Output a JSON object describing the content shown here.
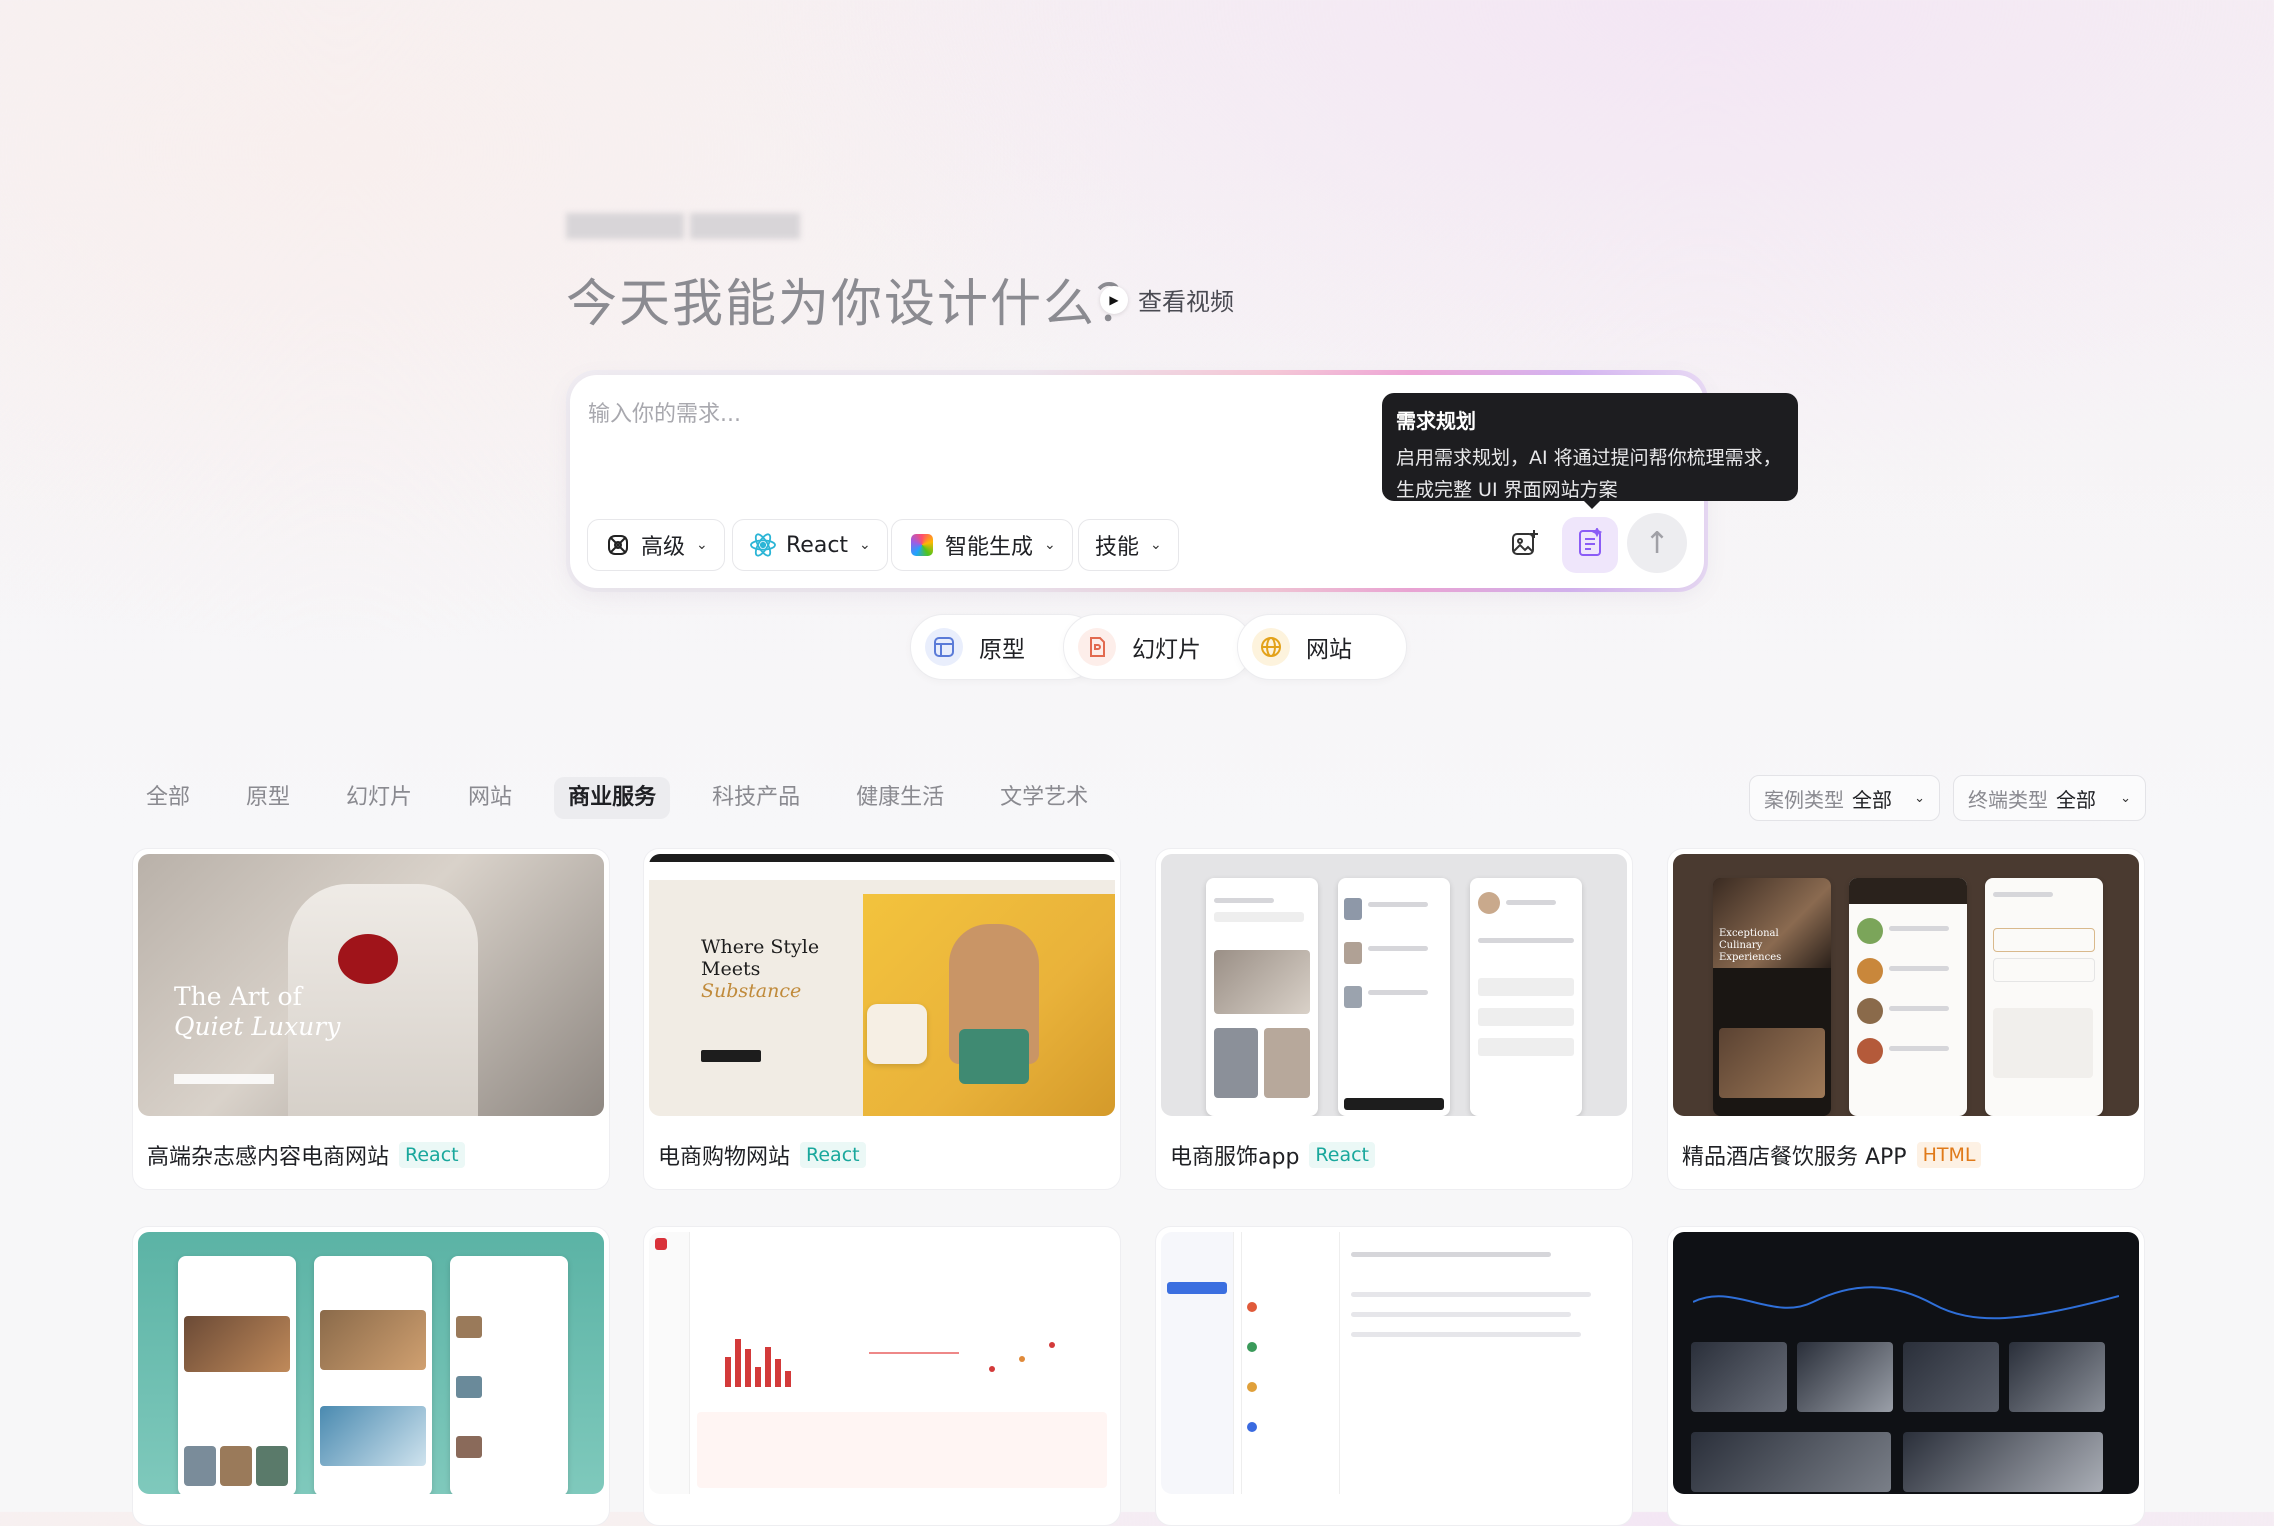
{
  "hero": {
    "title": "今天我能为你设计什么？",
    "video_link": "查看视频"
  },
  "composer": {
    "placeholder": "输入你的需求...",
    "chips": [
      {
        "label": "高级",
        "icon": "model-icon"
      },
      {
        "label": "React",
        "icon": "react-icon"
      },
      {
        "label": "智能生成",
        "icon": "color-grid-icon"
      },
      {
        "label": "技能",
        "icon": ""
      }
    ]
  },
  "tooltip": {
    "title": "需求规划",
    "line1": "启用需求规划，AI 将通过提问帮你梳理需求，",
    "line2": "生成完整 UI 界面网站方案"
  },
  "quick_types": [
    {
      "label": "原型",
      "icon": "prototype-icon",
      "color": "#5b7bd8"
    },
    {
      "label": "幻灯片",
      "icon": "slides-icon",
      "color": "#e26a4f"
    },
    {
      "label": "网站",
      "icon": "globe-icon",
      "color": "#e3a21a"
    }
  ],
  "categories": {
    "tabs": [
      "全部",
      "原型",
      "幻灯片",
      "网站",
      "商业服务",
      "科技产品",
      "健康生活",
      "文学艺术"
    ],
    "active_index": 4
  },
  "filters": {
    "case_type": {
      "key": "案例类型",
      "value": "全部"
    },
    "device_type": {
      "key": "终端类型",
      "value": "全部"
    }
  },
  "cards": [
    {
      "title": "高端杂志感内容电商网站",
      "tag": "React",
      "thumb_heading1": "The Art of",
      "thumb_heading2": "Quiet Luxury"
    },
    {
      "title": "电商购物网站",
      "tag": "React",
      "thumb_heading1": "Where Style",
      "thumb_heading2": "Meets",
      "thumb_heading3": "Substance"
    },
    {
      "title": "电商服饰app",
      "tag": "React"
    },
    {
      "title": "精品酒店餐饮服务 APP",
      "tag": "HTML",
      "thumb_heading1": "Exceptional Culinary Experiences"
    }
  ],
  "colors": {
    "accent_react": "#19a79c",
    "accent_html": "#e07a1a",
    "tooltip_bg": "#1d1d20"
  }
}
